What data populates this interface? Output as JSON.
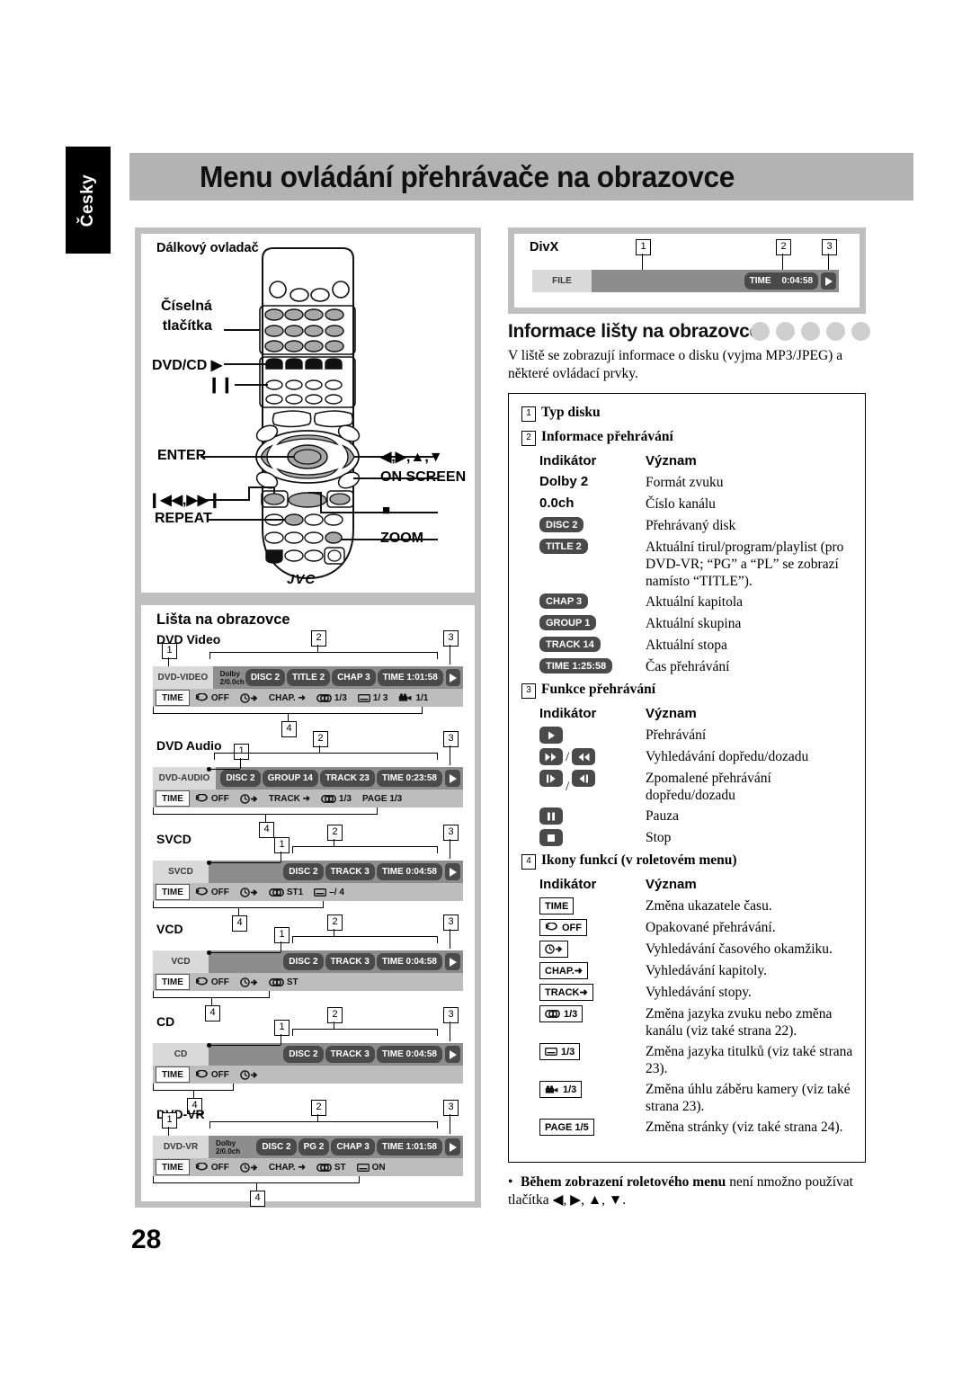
{
  "page": {
    "language_tab": "Česky",
    "title": "Menu ovládání přehrávače na obrazovce",
    "page_number": "28"
  },
  "remote_panel": {
    "title": "Dálkový ovladač",
    "brand": "JVC",
    "labels": {
      "numeric_buttons_l1": "Číselná",
      "numeric_buttons_l2": "tlačítka",
      "dvd_cd_play": "DVD/CD ▶",
      "pause": "❙❙",
      "enter": "ENTER",
      "skip": "❙◀◀,▶▶❙",
      "repeat": "REPEAT",
      "arrows": "◀,▶,▲,▼",
      "on_screen": "ON SCREEN",
      "stop": "■",
      "zoom": "ZOOM"
    }
  },
  "divx_panel": {
    "title": "DivX",
    "callouts": [
      "1",
      "2",
      "3"
    ],
    "bar": {
      "disc_tag": "FILE",
      "pills": [
        {
          "label": "TIME",
          "value": "0:04:58"
        }
      ],
      "play_icon": "play-icon"
    }
  },
  "bars_panel": {
    "heading": "Lišta na obrazovce",
    "bars": [
      {
        "name": "DVD Video",
        "disc_tag": "DVD-VIDEO",
        "dolby_l1": "Dolby",
        "dolby_l2": "2/0.0ch",
        "pills": [
          "DISC 2",
          "TITLE 2",
          "CHAP 3",
          "TIME  1:01:58"
        ],
        "functions": [
          "TIME",
          "OFF",
          "time-search",
          "CHAP.",
          "1/3",
          "1/ 3",
          "1/1"
        ],
        "func_display": [
          {
            "icon": "none",
            "text": "TIME",
            "boxed": true
          },
          {
            "icon": "repeat-icon",
            "text": "OFF",
            "boxed": false
          },
          {
            "icon": "clock-arrow-icon",
            "text": "",
            "boxed": false
          },
          {
            "icon": "none",
            "text": "CHAP. ➜",
            "boxed": false
          },
          {
            "icon": "audio-icon",
            "text": "1/3",
            "boxed": false
          },
          {
            "icon": "subtitle-icon",
            "text": "1/ 3",
            "boxed": false
          },
          {
            "icon": "angle-icon",
            "text": "1/1",
            "boxed": false
          }
        ],
        "callouts": [
          "1",
          "2",
          "3",
          "4"
        ]
      },
      {
        "name": "DVD Audio",
        "disc_tag": "DVD-AUDIO",
        "dolby_l1": "",
        "dolby_l2": "",
        "pills": [
          "DISC 2",
          "GROUP 14",
          "TRACK 23",
          "TIME  0:23:58"
        ],
        "func_display": [
          {
            "icon": "none",
            "text": "TIME",
            "boxed": true
          },
          {
            "icon": "repeat-icon",
            "text": "OFF",
            "boxed": false
          },
          {
            "icon": "clock-arrow-icon",
            "text": "",
            "boxed": false
          },
          {
            "icon": "none",
            "text": "TRACK ➜",
            "boxed": false
          },
          {
            "icon": "audio-icon",
            "text": "1/3",
            "boxed": false
          },
          {
            "icon": "none",
            "text": "PAGE 1/3",
            "boxed": false
          }
        ],
        "callouts": [
          "1",
          "2",
          "3",
          "4"
        ]
      },
      {
        "name": "SVCD",
        "disc_tag": "SVCD",
        "dolby_l1": "",
        "dolby_l2": "",
        "pills": [
          "DISC 2",
          "TRACK  3",
          "TIME    0:04:58"
        ],
        "func_display": [
          {
            "icon": "none",
            "text": "TIME",
            "boxed": true
          },
          {
            "icon": "repeat-icon",
            "text": "OFF",
            "boxed": false
          },
          {
            "icon": "clock-arrow-icon",
            "text": "",
            "boxed": false
          },
          {
            "icon": "audio-icon",
            "text": "ST1",
            "boxed": false
          },
          {
            "icon": "subtitle-icon",
            "text": "–/ 4",
            "boxed": false
          }
        ],
        "callouts": [
          "1",
          "2",
          "3",
          "4"
        ]
      },
      {
        "name": "VCD",
        "disc_tag": "VCD",
        "dolby_l1": "",
        "dolby_l2": "",
        "pills": [
          "DISC 2",
          "TRACK  3",
          "TIME    0:04:58"
        ],
        "func_display": [
          {
            "icon": "none",
            "text": "TIME",
            "boxed": true
          },
          {
            "icon": "repeat-icon",
            "text": "OFF",
            "boxed": false
          },
          {
            "icon": "clock-arrow-icon",
            "text": "",
            "boxed": false
          },
          {
            "icon": "audio-icon",
            "text": "ST",
            "boxed": false
          }
        ],
        "callouts": [
          "1",
          "2",
          "3",
          "4"
        ]
      },
      {
        "name": "CD",
        "disc_tag": "CD",
        "dolby_l1": "",
        "dolby_l2": "",
        "pills": [
          "DISC 2",
          "TRACK  3",
          "TIME    0:04:58"
        ],
        "func_display": [
          {
            "icon": "none",
            "text": "TIME",
            "boxed": true
          },
          {
            "icon": "repeat-icon",
            "text": "OFF",
            "boxed": false
          },
          {
            "icon": "clock-arrow-icon",
            "text": "",
            "boxed": false
          }
        ],
        "callouts": [
          "1",
          "2",
          "3",
          "4"
        ]
      },
      {
        "name": "DVD-VR",
        "disc_tag": "DVD-VR",
        "dolby_l1": "Dolby",
        "dolby_l2": "2/0.0ch",
        "pills": [
          "DISC 2",
          "PG  2",
          "CHAP 3",
          "TIME  1:01:58"
        ],
        "func_display": [
          {
            "icon": "none",
            "text": "TIME",
            "boxed": true
          },
          {
            "icon": "repeat-icon",
            "text": "OFF",
            "boxed": false
          },
          {
            "icon": "clock-arrow-icon",
            "text": "",
            "boxed": false
          },
          {
            "icon": "none",
            "text": "CHAP. ➜",
            "boxed": false
          },
          {
            "icon": "audio-icon",
            "text": "ST",
            "boxed": false
          },
          {
            "icon": "subtitle-icon",
            "text": "ON",
            "boxed": false
          }
        ],
        "callouts": [
          "1",
          "2",
          "3",
          "4"
        ]
      }
    ]
  },
  "info_section": {
    "heading": "Informace lišty na obrazovce",
    "disc_icons_count": 5,
    "intro": "V liště se zobrazují informace o disku (vyjma MP3/JPEG) a některé ovládací prvky.",
    "groups": [
      {
        "num": "1",
        "title": "Typ disku",
        "col_indicator": "",
        "col_meaning": "",
        "rows": []
      },
      {
        "num": "2",
        "title": "Informace přehrávání",
        "col_indicator": "Indikátor",
        "col_meaning": "Význam",
        "rows": [
          {
            "style": "plain",
            "label": "Dolby 2",
            "meaning": "Formát zvuku"
          },
          {
            "style": "plain",
            "label": "0.0ch",
            "meaning": "Číslo kanálu"
          },
          {
            "style": "dark",
            "label": "DISC 2",
            "meaning": "Přehrávaný disk"
          },
          {
            "style": "dark",
            "label": "TITLE  2",
            "meaning": "Aktuální tirul/program/playlist (pro DVD-VR; “PG” a “PL” se zobrazí namísto “TITLE”)."
          },
          {
            "style": "dark",
            "label": "CHAP  3",
            "meaning": "Aktuální kapitola"
          },
          {
            "style": "dark",
            "label": "GROUP 1",
            "meaning": "Aktuální skupina"
          },
          {
            "style": "dark",
            "label": "TRACK 14",
            "meaning": "Aktuální stopa"
          },
          {
            "style": "dark",
            "label": "TIME 1:25:58",
            "meaning": "Čas přehrávání"
          }
        ]
      },
      {
        "num": "3",
        "title": "Funkce přehrávání",
        "col_indicator": "Indikátor",
        "col_meaning": "Význam",
        "rows": [
          {
            "style": "btn",
            "icons": [
              "play-icon"
            ],
            "meaning": "Přehrávání"
          },
          {
            "style": "btn",
            "icons": [
              "fast-forward-icon",
              "rewind-icon"
            ],
            "meaning": "Vyhledávání dopředu/dozadu"
          },
          {
            "style": "btn",
            "icons": [
              "slow-forward-icon",
              "slow-reverse-icon"
            ],
            "meaning": "Zpomalené přehrávání dopředu/dozadu"
          },
          {
            "style": "btn",
            "icons": [
              "pause-icon"
            ],
            "meaning": "Pauza"
          },
          {
            "style": "btn",
            "icons": [
              "stop-icon"
            ],
            "meaning": "Stop"
          }
        ]
      },
      {
        "num": "4",
        "title": "Ikony funkcí (v roletovém menu)",
        "col_indicator": "Indikátor",
        "col_meaning": "Význam",
        "rows": [
          {
            "style": "box",
            "icon": "none",
            "label": "TIME",
            "meaning": "Změna ukazatele času."
          },
          {
            "style": "box",
            "icon": "repeat-icon",
            "label": "OFF",
            "meaning": "Opakované přehrávání."
          },
          {
            "style": "box",
            "icon": "clock-arrow-icon",
            "label": "",
            "meaning": "Vyhledávání časového okamžiku."
          },
          {
            "style": "box",
            "icon": "none",
            "label": "CHAP.➜",
            "meaning": "Vyhledávání kapitoly."
          },
          {
            "style": "box",
            "icon": "none",
            "label": "TRACK➜",
            "meaning": "Vyhledávání stopy."
          },
          {
            "style": "box",
            "icon": "audio-icon",
            "label": "1/3",
            "meaning": "Změna jazyka zvuku nebo změna kanálu (viz také strana 22)."
          },
          {
            "style": "box",
            "icon": "subtitle-icon",
            "label": "1/3",
            "meaning": "Změna jazyka titulků (viz také strana 23)."
          },
          {
            "style": "box",
            "icon": "angle-icon",
            "label": "1/3",
            "meaning": "Změna úhlu záběru kamery (viz také strana 23)."
          },
          {
            "style": "box",
            "icon": "none",
            "label": "PAGE 1/5",
            "meaning": "Změna stránky (viz také strana 24)."
          }
        ]
      }
    ],
    "note_bold": "Během zobrazení roletového menu",
    "note_rest": " není nmožno používat tlačítka ◀, ▶, ▲, ▼."
  },
  "colors": {
    "banner_gray": "#b3b3b3",
    "panel_border_gray": "#bfbfbf",
    "bar_top_gray": "#8d8d8d",
    "bar_bottom_gray": "#bdbdbd",
    "tag_light": "#d9d9d9",
    "pill_dark": "#4a4a4a",
    "disc_circle_gray": "#cfcfcf"
  }
}
